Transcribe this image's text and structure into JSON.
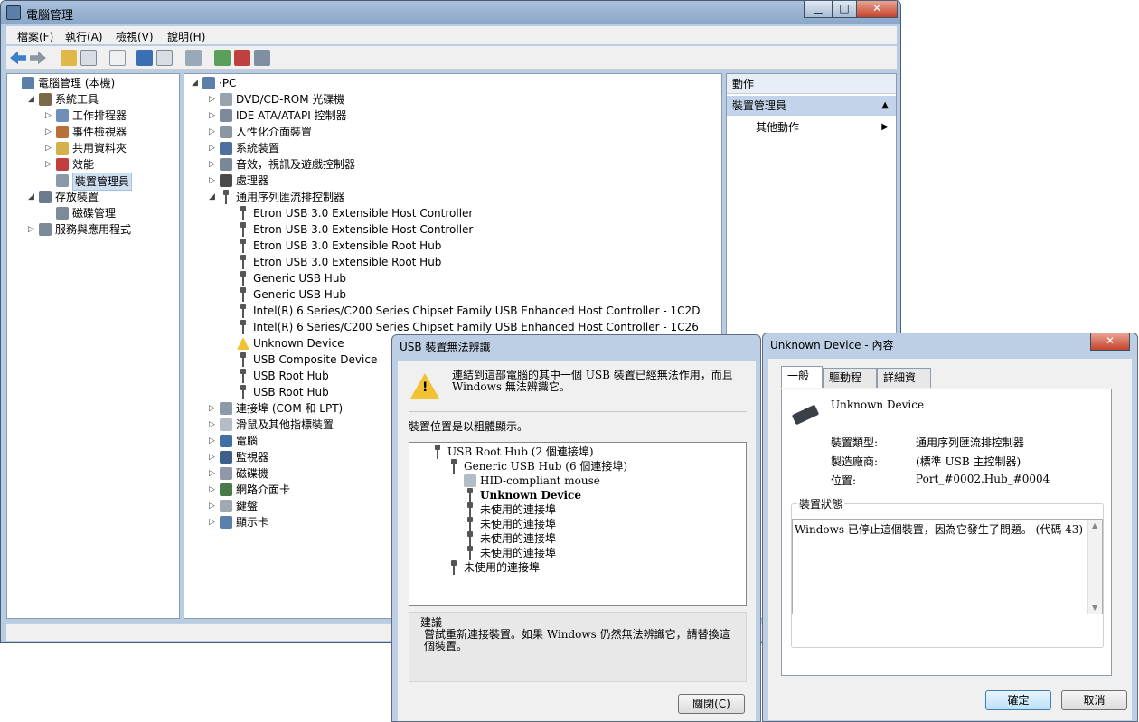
{
  "mmc": {
    "title": "電腦管理",
    "min": "▁",
    "max": "□",
    "close": "✕",
    "menu": [
      "檔案(F)",
      "執行(A)",
      "檢視(V)",
      "說明(H)"
    ],
    "left_tree": [
      {
        "label": "電腦管理 (本機)",
        "level": 0,
        "twisty": "",
        "icon": "computer-management-icon"
      },
      {
        "label": "系統工具",
        "level": 1,
        "twisty": "◢",
        "icon": "system-tools-icon"
      },
      {
        "label": "工作排程器",
        "level": 2,
        "twisty": "▷",
        "icon": "task-scheduler-icon"
      },
      {
        "label": "事件檢視器",
        "level": 2,
        "twisty": "▷",
        "icon": "event-viewer-icon"
      },
      {
        "label": "共用資料夾",
        "level": 2,
        "twisty": "▷",
        "icon": "shared-folders-icon"
      },
      {
        "label": "效能",
        "level": 2,
        "twisty": "▷",
        "icon": "performance-icon"
      },
      {
        "label": "裝置管理員",
        "level": 2,
        "twisty": "",
        "icon": "device-manager-icon",
        "selected": true
      },
      {
        "label": "存放裝置",
        "level": 1,
        "twisty": "◢",
        "icon": "storage-icon"
      },
      {
        "label": "磁碟管理",
        "level": 2,
        "twisty": "",
        "icon": "disk-management-icon"
      },
      {
        "label": "服務與應用程式",
        "level": 1,
        "twisty": "▷",
        "icon": "services-icon"
      }
    ],
    "device_tree": [
      {
        "label": "·PC",
        "level": 0,
        "twisty": "◢",
        "icon": "pc-icon"
      },
      {
        "label": "DVD/CD-ROM 光碟機",
        "level": 1,
        "twisty": "▷",
        "icon": "dvd-icon"
      },
      {
        "label": "IDE ATA/ATAPI 控制器",
        "level": 1,
        "twisty": "▷",
        "icon": "ide-icon"
      },
      {
        "label": "人性化介面裝置",
        "level": 1,
        "twisty": "▷",
        "icon": "hid-icon"
      },
      {
        "label": "系統裝置",
        "level": 1,
        "twisty": "▷",
        "icon": "system-device-icon"
      },
      {
        "label": "音效，視訊及遊戲控制器",
        "level": 1,
        "twisty": "▷",
        "icon": "sound-icon"
      },
      {
        "label": "處理器",
        "level": 1,
        "twisty": "▷",
        "icon": "processor-icon"
      },
      {
        "label": "通用序列匯流排控制器",
        "level": 1,
        "twisty": "◢",
        "icon": "usb-icon"
      },
      {
        "label": "Etron USB 3.0 Extensible Host Controller",
        "level": 2,
        "twisty": "",
        "icon": "usb-icon"
      },
      {
        "label": "Etron USB 3.0 Extensible Host Controller",
        "level": 2,
        "twisty": "",
        "icon": "usb-icon"
      },
      {
        "label": "Etron USB 3.0 Extensible Root Hub",
        "level": 2,
        "twisty": "",
        "icon": "usb-icon"
      },
      {
        "label": "Etron USB 3.0 Extensible Root Hub",
        "level": 2,
        "twisty": "",
        "icon": "usb-icon"
      },
      {
        "label": "Generic USB Hub",
        "level": 2,
        "twisty": "",
        "icon": "usb-icon"
      },
      {
        "label": "Generic USB Hub",
        "level": 2,
        "twisty": "",
        "icon": "usb-icon"
      },
      {
        "label": "Intel(R) 6 Series/C200 Series Chipset Family USB Enhanced Host Controller - 1C2D",
        "level": 2,
        "twisty": "",
        "icon": "usb-icon"
      },
      {
        "label": "Intel(R) 6 Series/C200 Series Chipset Family USB Enhanced Host Controller - 1C26",
        "level": 2,
        "twisty": "",
        "icon": "usb-icon"
      },
      {
        "label": "Unknown Device",
        "level": 2,
        "twisty": "",
        "icon": "warning-icon"
      },
      {
        "label": "USB Composite Device",
        "level": 2,
        "twisty": "",
        "icon": "usb-icon"
      },
      {
        "label": "USB Root Hub",
        "level": 2,
        "twisty": "",
        "icon": "usb-icon"
      },
      {
        "label": "USB Root Hub",
        "level": 2,
        "twisty": "",
        "icon": "usb-icon"
      },
      {
        "label": "連接埠 (COM 和 LPT)",
        "level": 1,
        "twisty": "▷",
        "icon": "port-icon"
      },
      {
        "label": "滑鼠及其他指標裝置",
        "level": 1,
        "twisty": "▷",
        "icon": "mouse-icon"
      },
      {
        "label": "電腦",
        "level": 1,
        "twisty": "▷",
        "icon": "computer-icon"
      },
      {
        "label": "監視器",
        "level": 1,
        "twisty": "▷",
        "icon": "monitor-icon"
      },
      {
        "label": "磁碟機",
        "level": 1,
        "twisty": "▷",
        "icon": "disk-drive-icon"
      },
      {
        "label": "網路介面卡",
        "level": 1,
        "twisty": "▷",
        "icon": "network-adapter-icon"
      },
      {
        "label": "鍵盤",
        "level": 1,
        "twisty": "▷",
        "icon": "keyboard-icon"
      },
      {
        "label": "顯示卡",
        "level": 1,
        "twisty": "▷",
        "icon": "display-adapter-icon"
      }
    ],
    "actions": {
      "header": "動作",
      "section": "裝置管理員",
      "item": "其他動作"
    }
  },
  "usb_dialog": {
    "title": "USB 裝置無法辨識",
    "message": "連結到這部電腦的其中一個 USB 裝置已經無法作用，而且 Windows 無法辨識它。",
    "location_label": "裝置位置是以粗體顯示。",
    "tree": [
      {
        "label": "USB Root Hub (2 個連接埠)",
        "level": 0,
        "bold": false,
        "icon": "usb-icon"
      },
      {
        "label": "Generic USB Hub (6 個連接埠)",
        "level": 1,
        "bold": false,
        "icon": "usb-icon"
      },
      {
        "label": "HID-compliant mouse",
        "level": 2,
        "bold": false,
        "icon": "mouse-icon"
      },
      {
        "label": "Unknown Device",
        "level": 2,
        "bold": true,
        "icon": "usb-icon"
      },
      {
        "label": "未使用的連接埠",
        "level": 2,
        "bold": false,
        "icon": "usb-icon"
      },
      {
        "label": "未使用的連接埠",
        "level": 2,
        "bold": false,
        "icon": "usb-icon"
      },
      {
        "label": "未使用的連接埠",
        "level": 2,
        "bold": false,
        "icon": "usb-icon"
      },
      {
        "label": "未使用的連接埠",
        "level": 2,
        "bold": false,
        "icon": "usb-icon"
      },
      {
        "label": "未使用的連接埠",
        "level": 1,
        "bold": false,
        "icon": "usb-icon"
      }
    ],
    "suggestion_title": "建議",
    "suggestion": "嘗試重新連接裝置。如果 Windows 仍然無法辨識它，請替換這個裝置。",
    "close_button": "關閉(C)"
  },
  "props_dialog": {
    "title": "Unknown Device - 內容",
    "close": "✕",
    "tabs": [
      "一般",
      "驅動程式",
      "詳細資料"
    ],
    "device_name": "Unknown Device",
    "fields": [
      {
        "label": "裝置類型:",
        "value": "通用序列匯流排控制器"
      },
      {
        "label": "製造廠商:",
        "value": "(標準 USB 主控制器)"
      },
      {
        "label": "位置:",
        "value": "Port_#0002.Hub_#0004"
      }
    ],
    "status_title": "裝置狀態",
    "status_text": "Windows 已停止這個裝置，因為它發生了問題。 (代碼 43)",
    "ok_button": "確定",
    "cancel_button": "取消"
  },
  "colors": {
    "chrome": "#b8cde3",
    "selection": "#cfdff2",
    "action_header": "#c3d4ea",
    "warning": "#f2c233"
  }
}
